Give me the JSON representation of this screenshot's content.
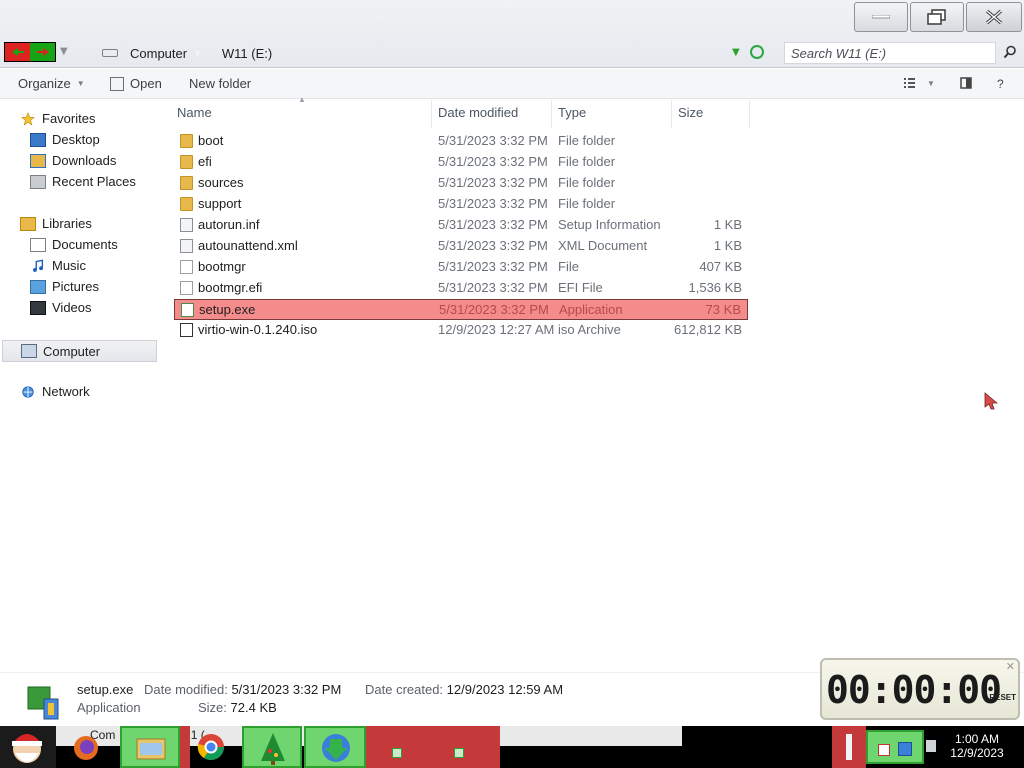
{
  "titlebar": {
    "breadcrumb": [
      "Computer",
      "W11 (E:)"
    ],
    "search_placeholder": "Search W11 (E:)"
  },
  "toolbar": {
    "organize": "Organize",
    "open": "Open",
    "new_folder": "New folder"
  },
  "sidebar": {
    "favorites": "Favorites",
    "favorites_items": [
      "Desktop",
      "Downloads",
      "Recent Places"
    ],
    "libraries": "Libraries",
    "libraries_items": [
      "Documents",
      "Music",
      "Pictures",
      "Videos"
    ],
    "computer": "Computer",
    "network": "Network"
  },
  "columns": {
    "name": "Name",
    "date": "Date modified",
    "type": "Type",
    "size": "Size"
  },
  "files": [
    {
      "name": "boot",
      "date": "5/31/2023 3:32 PM",
      "type": "File folder",
      "size": "",
      "icon": "folder-icon"
    },
    {
      "name": "efi",
      "date": "5/31/2023 3:32 PM",
      "type": "File folder",
      "size": "",
      "icon": "folder-icon"
    },
    {
      "name": "sources",
      "date": "5/31/2023 3:32 PM",
      "type": "File folder",
      "size": "",
      "icon": "folder-icon"
    },
    {
      "name": "support",
      "date": "5/31/2023 3:32 PM",
      "type": "File folder",
      "size": "",
      "icon": "folder-icon"
    },
    {
      "name": "autorun.inf",
      "date": "5/31/2023 3:32 PM",
      "type": "Setup Information",
      "size": "1 KB",
      "icon": "settings-file-icon"
    },
    {
      "name": "autounattend.xml",
      "date": "5/31/2023 3:32 PM",
      "type": "XML Document",
      "size": "1 KB",
      "icon": "xml-file-icon"
    },
    {
      "name": "bootmgr",
      "date": "5/31/2023 3:32 PM",
      "type": "File",
      "size": "407 KB",
      "icon": "file-icon"
    },
    {
      "name": "bootmgr.efi",
      "date": "5/31/2023 3:32 PM",
      "type": "EFI File",
      "size": "1,536 KB",
      "icon": "file-icon"
    },
    {
      "name": "setup.exe",
      "date": "5/31/2023 3:32 PM",
      "type": "Application",
      "size": "73 KB",
      "icon": "setup-exe-icon",
      "selected": true
    },
    {
      "name": "virtio-win-0.1.240.iso",
      "date": "12/9/2023 12:27 AM",
      "type": "iso Archive",
      "size": "612,812 KB",
      "icon": "iso-file-icon"
    }
  ],
  "details": {
    "name": "setup.exe",
    "kind": "Application",
    "modified_label": "Date modified:",
    "modified_value": "5/31/2023 3:32 PM",
    "created_label": "Date created:",
    "created_value": "12/9/2023 12:59 AM",
    "size_label": "Size:",
    "size_value": "72.4 KB"
  },
  "timer": {
    "value": "00:00:00",
    "reset_label": "RESET"
  },
  "taskbar": {
    "input_text": "Com",
    "input_text2": "1 (",
    "clock_time": "1:00 AM",
    "clock_date": "12/9/2023"
  },
  "colors": {
    "selection": "#f48c8c",
    "accent_green": "#2ea02e",
    "accent_red": "#d22222"
  }
}
